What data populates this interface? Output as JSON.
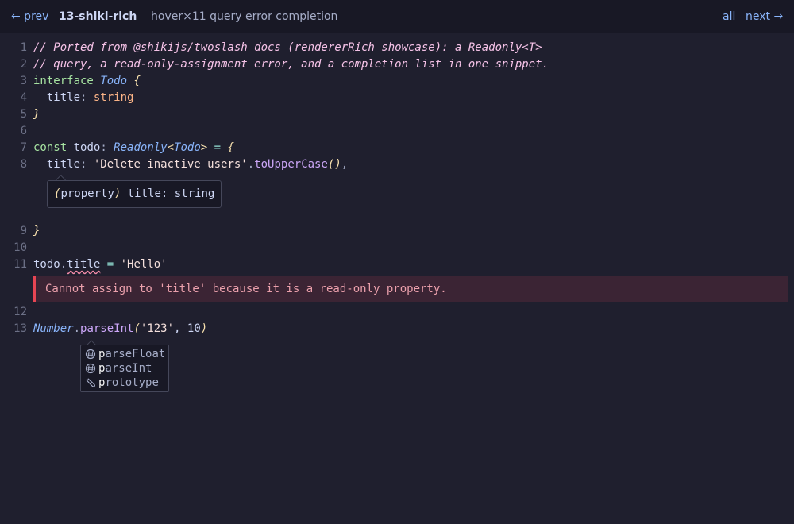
{
  "topbar": {
    "prev_label": "← prev",
    "title": "13-shiki-rich",
    "subtitle": "hover×11 query error completion",
    "all_label": "all",
    "next_label": "next →"
  },
  "code": {
    "lines": [
      {
        "n": "1",
        "tokens": [
          {
            "t": "// Ported from @shikijs/twoslash docs (rendererRich showcase): a Readonly<T>",
            "k": "c"
          }
        ]
      },
      {
        "n": "2",
        "tokens": [
          {
            "t": "// query, a read-only-assignment error, and a completion list in one snippet.",
            "k": "c"
          }
        ]
      },
      {
        "n": "3",
        "tokens": [
          {
            "t": "interface",
            "k": "kw"
          },
          {
            "t": " ",
            "k": "pl"
          },
          {
            "t": "Todo",
            "k": "ty"
          },
          {
            "t": " ",
            "k": "pl"
          },
          {
            "t": "{",
            "k": "br"
          }
        ]
      },
      {
        "n": "4",
        "tokens": [
          {
            "t": "  title",
            "k": "pl"
          },
          {
            "t": ": ",
            "k": "mu"
          },
          {
            "t": "string",
            "k": "st"
          }
        ]
      },
      {
        "n": "5",
        "tokens": [
          {
            "t": "}",
            "k": "br"
          }
        ]
      },
      {
        "n": "6",
        "tokens": []
      },
      {
        "n": "7",
        "tokens": [
          {
            "t": "const",
            "k": "kw"
          },
          {
            "t": " todo",
            "k": "pl"
          },
          {
            "t": ": ",
            "k": "mu"
          },
          {
            "t": "Readonly",
            "k": "ty"
          },
          {
            "t": "<",
            "k": "br"
          },
          {
            "t": "Todo",
            "k": "ty"
          },
          {
            "t": ">",
            "k": "br"
          },
          {
            "t": " = ",
            "k": "op"
          },
          {
            "t": "{",
            "k": "br"
          }
        ]
      },
      {
        "n": "8",
        "tokens": [
          {
            "t": "  title",
            "k": "pl"
          },
          {
            "t": ": ",
            "k": "mu"
          },
          {
            "t": "'Delete inactive users'",
            "k": "str"
          },
          {
            "t": ".",
            "k": "mu"
          },
          {
            "t": "toUpperCase",
            "k": "fn"
          },
          {
            "t": "()",
            "k": "br"
          },
          {
            "t": ",",
            "k": "mu"
          }
        ]
      },
      {
        "n": "9",
        "tokens": [
          {
            "t": "}",
            "k": "br"
          }
        ]
      },
      {
        "n": "10",
        "tokens": []
      },
      {
        "n": "11",
        "tokens": [
          {
            "t": "todo",
            "k": "pl"
          },
          {
            "t": ".",
            "k": "mu"
          },
          {
            "t": "title",
            "k": "pl",
            "err": true
          },
          {
            "t": " = ",
            "k": "op"
          },
          {
            "t": "'Hello'",
            "k": "str"
          }
        ]
      },
      {
        "n": "12",
        "tokens": []
      },
      {
        "n": "13",
        "tokens": [
          {
            "t": "Number",
            "k": "ty"
          },
          {
            "t": ".",
            "k": "mu"
          },
          {
            "t": "parseInt",
            "k": "fn"
          },
          {
            "t": "(",
            "k": "br"
          },
          {
            "t": "'123'",
            "k": "str"
          },
          {
            "t": ", 10",
            "k": "pl"
          },
          {
            "t": ")",
            "k": "br"
          }
        ]
      }
    ]
  },
  "hover": {
    "paren_open": "(",
    "kind": "property",
    "paren_close": ")",
    "text": " title: string"
  },
  "error": {
    "message": "Cannot assign to 'title' because it is a read-only property."
  },
  "completion": {
    "items": [
      {
        "icon": "method-icon",
        "match": "p",
        "rest": "arseFloat"
      },
      {
        "icon": "method-icon",
        "match": "p",
        "rest": "arseInt"
      },
      {
        "icon": "wrench-icon",
        "match": "p",
        "rest": "rototype"
      }
    ]
  },
  "colors": {
    "background": "#1f1f2e",
    "topbar": "#181825",
    "link": "#89b4fa",
    "error_accent": "#e64553"
  }
}
